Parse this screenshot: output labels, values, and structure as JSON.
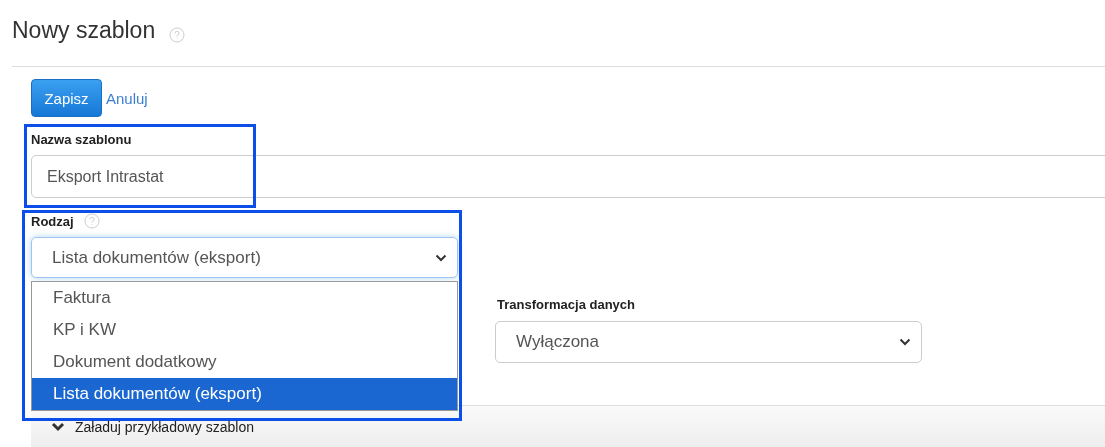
{
  "page": {
    "title": "Nowy szablon"
  },
  "actions": [
    {
      "kind": "primary",
      "label": "Zapisz"
    },
    {
      "kind": "link",
      "label": "Anuluj"
    }
  ],
  "name_field": {
    "label": "Nazwa szablonu",
    "value": "Eksport Intrastat",
    "highlighted": true
  },
  "type_field": {
    "label": "Rodzaj",
    "value": "Lista dokumentów (eksport)",
    "expanded": true,
    "highlighted": true,
    "options": [
      {
        "label": "Faktura",
        "selected": false
      },
      {
        "label": "KP i KW",
        "selected": false
      },
      {
        "label": "Dokument dodatkowy",
        "selected": false
      },
      {
        "label": "Lista dokumentów (eksport)",
        "selected": true
      }
    ]
  },
  "transform_field": {
    "label": "Transformacja danych",
    "value": "Wyłączona"
  },
  "panel": {
    "label": "Załaduj przykładowy szablon",
    "expanded": false
  }
}
